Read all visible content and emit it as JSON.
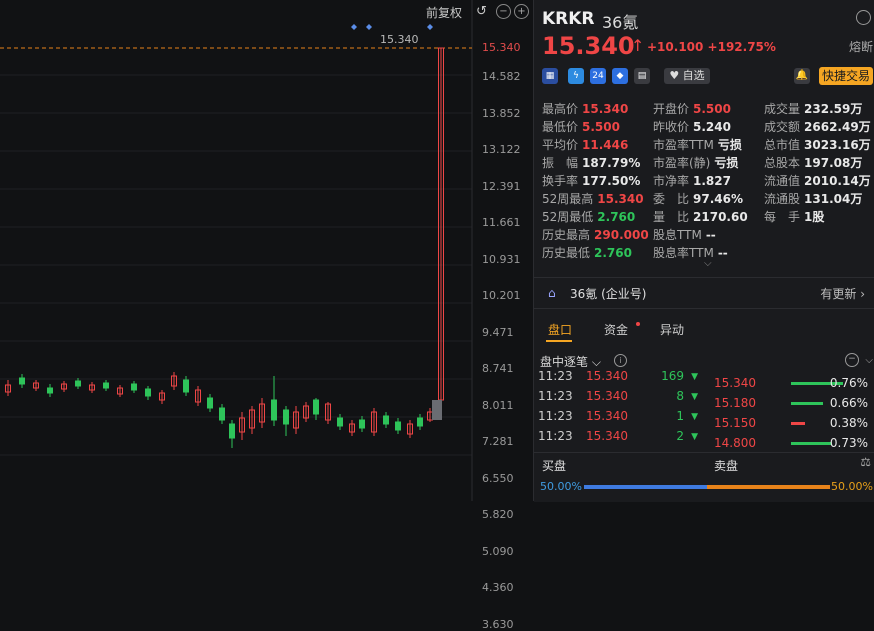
{
  "chart": {
    "tool_restore": "前复权",
    "price_line_label": "15.340",
    "price_tag": "15.340",
    "y_ticks": [
      "14.582",
      "13.852",
      "13.122",
      "12.391",
      "11.661",
      "10.931",
      "10.201",
      "9.471",
      "8.741",
      "8.011",
      "7.281",
      "6.550",
      "5.820",
      "5.090",
      "4.360",
      "3.630"
    ]
  },
  "header": {
    "symbol": "KRKR",
    "name": "36氪",
    "price": "15.340",
    "change": "+10.100 +192.75%",
    "melt": "熔断",
    "watch_label": "自选",
    "quick_trade": "快捷交易",
    "badge_24": "24"
  },
  "stats": [
    [
      {
        "l": "最高价",
        "v": "15.340",
        "c": "red"
      },
      {
        "l": "开盘价",
        "v": "5.500",
        "c": "red"
      },
      {
        "l": "成交量",
        "v": "232.59万",
        "c": "white"
      }
    ],
    [
      {
        "l": "最低价",
        "v": "5.500",
        "c": "red"
      },
      {
        "l": "昨收价",
        "v": "5.240",
        "c": "white"
      },
      {
        "l": "成交额",
        "v": "2662.49万",
        "c": "white"
      }
    ],
    [
      {
        "l": "平均价",
        "v": "11.446",
        "c": "red"
      },
      {
        "l": "市盈率TTM",
        "v": "亏损",
        "c": "white"
      },
      {
        "l": "总市值",
        "v": "3023.16万",
        "c": "white"
      }
    ],
    [
      {
        "l": "振　幅",
        "v": "187.79%",
        "c": "white"
      },
      {
        "l": "市盈率(静)",
        "v": "亏损",
        "c": "white"
      },
      {
        "l": "总股本",
        "v": "197.08万",
        "c": "white"
      }
    ],
    [
      {
        "l": "换手率",
        "v": "177.50%",
        "c": "white"
      },
      {
        "l": "市净率",
        "v": "1.827",
        "c": "white"
      },
      {
        "l": "流通值",
        "v": "2010.14万",
        "c": "white"
      }
    ],
    [
      {
        "l": "52周最高",
        "v": "15.340",
        "c": "red"
      },
      {
        "l": "委　比",
        "v": "97.46%",
        "c": "white"
      },
      {
        "l": "流通股",
        "v": "131.04万",
        "c": "white"
      }
    ],
    [
      {
        "l": "52周最低",
        "v": "2.760",
        "c": "green"
      },
      {
        "l": "量　比",
        "v": "2170.60",
        "c": "white"
      },
      {
        "l": "每　手",
        "v": "1股",
        "c": "white"
      }
    ],
    [
      {
        "l": "历史最高",
        "v": "290.000",
        "c": "red"
      },
      {
        "l": "股息TTM",
        "v": "--",
        "c": "white"
      }
    ],
    [
      {
        "l": "历史最低",
        "v": "2.760",
        "c": "green"
      },
      {
        "l": "股息率TTM",
        "v": "--",
        "c": "white"
      }
    ]
  ],
  "corp": {
    "name": "36氪 (企业号)",
    "update": "有更新"
  },
  "tabs": {
    "t1": "盘口",
    "t2": "资金",
    "t3": "异动"
  },
  "ticks": {
    "title": "盘中逐笔",
    "rows": [
      {
        "t": "11:23",
        "p": "15.340",
        "v": "169"
      },
      {
        "t": "11:23",
        "p": "15.340",
        "v": "8"
      },
      {
        "t": "11:23",
        "p": "15.340",
        "v": "1"
      },
      {
        "t": "11:23",
        "p": "15.340",
        "v": "2"
      }
    ]
  },
  "depth": [
    {
      "p": "15.340",
      "pc": "0.76%",
      "bar": "#2ec45a",
      "w": 52
    },
    {
      "p": "15.180",
      "pc": "0.66%",
      "bar": "#2ec45a",
      "w": 32
    },
    {
      "p": "15.150",
      "pc": "0.38%",
      "bar": "#ef4646",
      "w": 14
    },
    {
      "p": "14.800",
      "pc": "0.73%",
      "bar": "#2ec45a",
      "w": 40
    }
  ],
  "bs": {
    "buy": "买盘",
    "sell": "卖盘",
    "buy_pct": "50.00%",
    "sell_pct": "50.00%"
  }
}
